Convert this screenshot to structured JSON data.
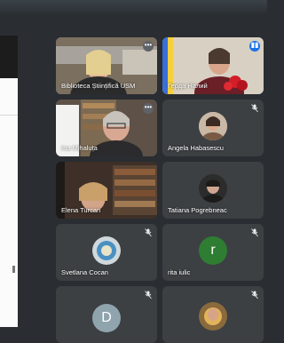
{
  "participants": [
    {
      "name": "Biblioteca Științifică USM",
      "avatar_letter": ""
    },
    {
      "name": "Герда Налий",
      "avatar_letter": ""
    },
    {
      "name": "Ina Mihaluța",
      "avatar_letter": ""
    },
    {
      "name": "Angela Habasescu",
      "avatar_letter": ""
    },
    {
      "name": "Elena Turcan",
      "avatar_letter": ""
    },
    {
      "name": "Tatiana Pogrebneac",
      "avatar_letter": ""
    },
    {
      "name": "Svetlana Cocan",
      "avatar_letter": ""
    },
    {
      "name": "rita iulic",
      "avatar_letter": "r"
    },
    {
      "name": "",
      "avatar_letter": "D"
    },
    {
      "name": "",
      "avatar_letter": ""
    }
  ],
  "icons": {
    "more": "more-options-icon",
    "mic_off": "mic-off-icon",
    "speaking": "audio-active-icon"
  },
  "colors": {
    "tile_bg": "#3c4043",
    "active_border": "#8ab4f8",
    "avatar_green": "#2e7d32",
    "avatar_gray": "#90a4ae"
  }
}
